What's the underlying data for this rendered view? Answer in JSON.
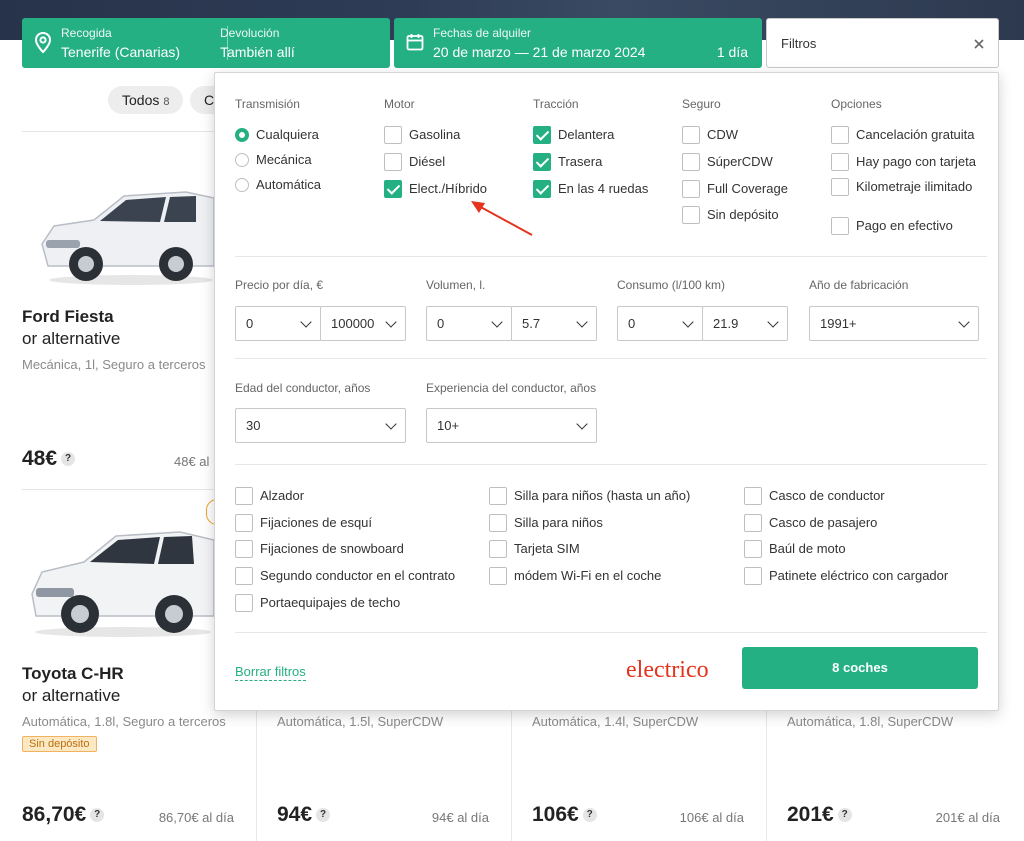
{
  "search": {
    "pickup_label": "Recogida",
    "pickup_value": "Tenerife (Canarias)",
    "return_label": "Devolución",
    "return_value": "También allí",
    "dates_label": "Fechas de alquiler",
    "dates_value": "20 de marzo — 21 de marzo 2024",
    "days": "1 día",
    "filters_label": "Filtros"
  },
  "chips": [
    {
      "label": "Todos",
      "count": "8"
    },
    {
      "label": "Co",
      "count": ""
    }
  ],
  "cars": [
    {
      "title": "Ford Fiesta",
      "subtitle": "or alternative",
      "spec": "Mecánica, 1l, Seguro a terceros",
      "price": "48€",
      "price_day": "48€ al"
    },
    {
      "title": "Toyota C-HR",
      "subtitle": "or alternative",
      "spec": "Automática, 1.8l, Seguro a terceros",
      "badge": "Sin depósito",
      "price": "86,70€",
      "price_day": "86,70€ al día"
    },
    {
      "spec": "Automática, 1.5l, SuperCDW",
      "price": "94€",
      "price_day": "94€ al día"
    },
    {
      "spec": "Automática, 1.4l, SuperCDW",
      "price": "106€",
      "price_day": "106€ al día"
    },
    {
      "spec": "Automática, 1.8l, SuperCDW",
      "price": "201€",
      "price_day": "201€ al día"
    }
  ],
  "filters": {
    "transmission": {
      "title": "Transmisión",
      "options": [
        "Cualquiera",
        "Mecánica",
        "Automática"
      ],
      "selected": "Cualquiera"
    },
    "motor": {
      "title": "Motor",
      "options": [
        {
          "label": "Gasolina",
          "checked": false
        },
        {
          "label": "Diésel",
          "checked": false
        },
        {
          "label": "Elect./Híbrido",
          "checked": true
        }
      ]
    },
    "traction": {
      "title": "Tracción",
      "options": [
        {
          "label": "Delantera",
          "checked": true
        },
        {
          "label": "Trasera",
          "checked": true
        },
        {
          "label": "En las 4 ruedas",
          "checked": true
        }
      ]
    },
    "insurance": {
      "title": "Seguro",
      "options": [
        {
          "label": "CDW",
          "checked": false
        },
        {
          "label": "SúperCDW",
          "checked": false
        },
        {
          "label": "Full Coverage",
          "checked": false
        },
        {
          "label": "Sin depósito",
          "checked": false
        }
      ]
    },
    "options": {
      "title": "Opciones",
      "options": [
        {
          "label": "Cancelación gratuita",
          "checked": false
        },
        {
          "label": "Hay pago con tarjeta",
          "checked": false
        },
        {
          "label": "Kilometraje ilimitado",
          "checked": false
        },
        {
          "label": "Pago en efectivo",
          "checked": false
        }
      ]
    },
    "price": {
      "label": "Precio por día, €",
      "min": "0",
      "max": "100000"
    },
    "volume": {
      "label": "Volumen, l.",
      "min": "0",
      "max": "5.7"
    },
    "consumption": {
      "label": "Consumo (l/100 km)",
      "min": "0",
      "max": "21.9"
    },
    "year": {
      "label": "Año de fabricación",
      "value": "1991+"
    },
    "driver_age": {
      "label": "Edad del conductor, años",
      "value": "30"
    },
    "driver_experience": {
      "label": "Experiencia del conductor, años",
      "value": "10+"
    },
    "extras": [
      [
        "Alzador",
        "Fijaciones de esquí",
        "Fijaciones de snowboard",
        "Segundo conductor en el contrato",
        "Portaequipajes de techo"
      ],
      [
        "Silla para niños (hasta un año)",
        "Silla para niños",
        "Tarjeta SIM",
        "módem Wi-Fi en el coche"
      ],
      [
        "Casco de conductor",
        "Casco de pasajero",
        "Baúl de moto",
        "Patinete eléctrico con cargador"
      ]
    ],
    "clear_label": "Borrar filtros",
    "submit_label": "8 coches"
  },
  "annotation": {
    "text": "electrico",
    "color": "#e5331d"
  },
  "colors": {
    "accent": "#25b084",
    "annotation": "#e5331d"
  }
}
